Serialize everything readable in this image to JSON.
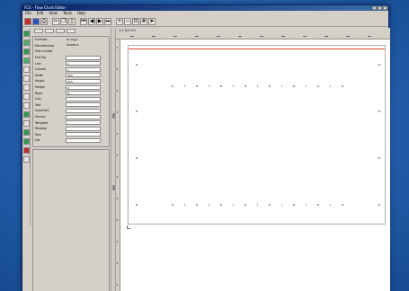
{
  "window": {
    "title": "FCE - Flow Chart Editor",
    "menu": [
      "File",
      "Edit",
      "View",
      "Tools",
      "Help"
    ]
  },
  "toolbar": {
    "buttons": [
      {
        "name": "open-icon",
        "glyph": "▤"
      },
      {
        "name": "save-icon",
        "glyph": "▣"
      },
      {
        "name": "print-icon",
        "glyph": "⎙"
      },
      {
        "name": "cut-icon",
        "glyph": "✂"
      },
      {
        "name": "copy-icon",
        "glyph": "❐"
      },
      {
        "name": "paste-icon",
        "glyph": "▯"
      },
      {
        "name": "first-icon",
        "glyph": "⏮"
      },
      {
        "name": "prev-icon",
        "glyph": "◀"
      },
      {
        "name": "next-icon",
        "glyph": "▶"
      },
      {
        "name": "last-icon",
        "glyph": "⏭"
      },
      {
        "name": "zoom-in-icon",
        "glyph": "+"
      },
      {
        "name": "zoom-out-icon",
        "glyph": "−"
      },
      {
        "name": "fit-icon",
        "glyph": "⊡"
      },
      {
        "name": "grid-icon",
        "glyph": "#"
      },
      {
        "name": "arrow-icon",
        "glyph": "➤"
      }
    ]
  },
  "properties": {
    "rows": [
      {
        "label": "Function",
        "value": "No Page"
      },
      {
        "label": "Manufacturer",
        "value": "MODBUS"
      },
      {
        "label": "Part number",
        "value": ""
      },
      {
        "label": "Part No.",
        "value": ""
      },
      {
        "label": "Line",
        "value": "1"
      },
      {
        "label": "Column",
        "value": "1"
      },
      {
        "label": "Width",
        "value": "400"
      },
      {
        "label": "Height",
        "value": "215"
      },
      {
        "label": "Margin",
        "value": "0"
      },
      {
        "label": "Rows",
        "value": "8"
      },
      {
        "label": "Cols",
        "value": ""
      },
      {
        "label": "Text",
        "value": ""
      },
      {
        "label": "Comment",
        "value": ""
      },
      {
        "label": "Version",
        "value": ""
      },
      {
        "label": "Template",
        "value": ""
      },
      {
        "label": "Revision",
        "value": ""
      },
      {
        "label": "Rem",
        "value": ""
      },
      {
        "label": "Cat",
        "value": ""
      }
    ]
  },
  "canvas": {
    "coords": "1:1    X:0  Y:0"
  }
}
